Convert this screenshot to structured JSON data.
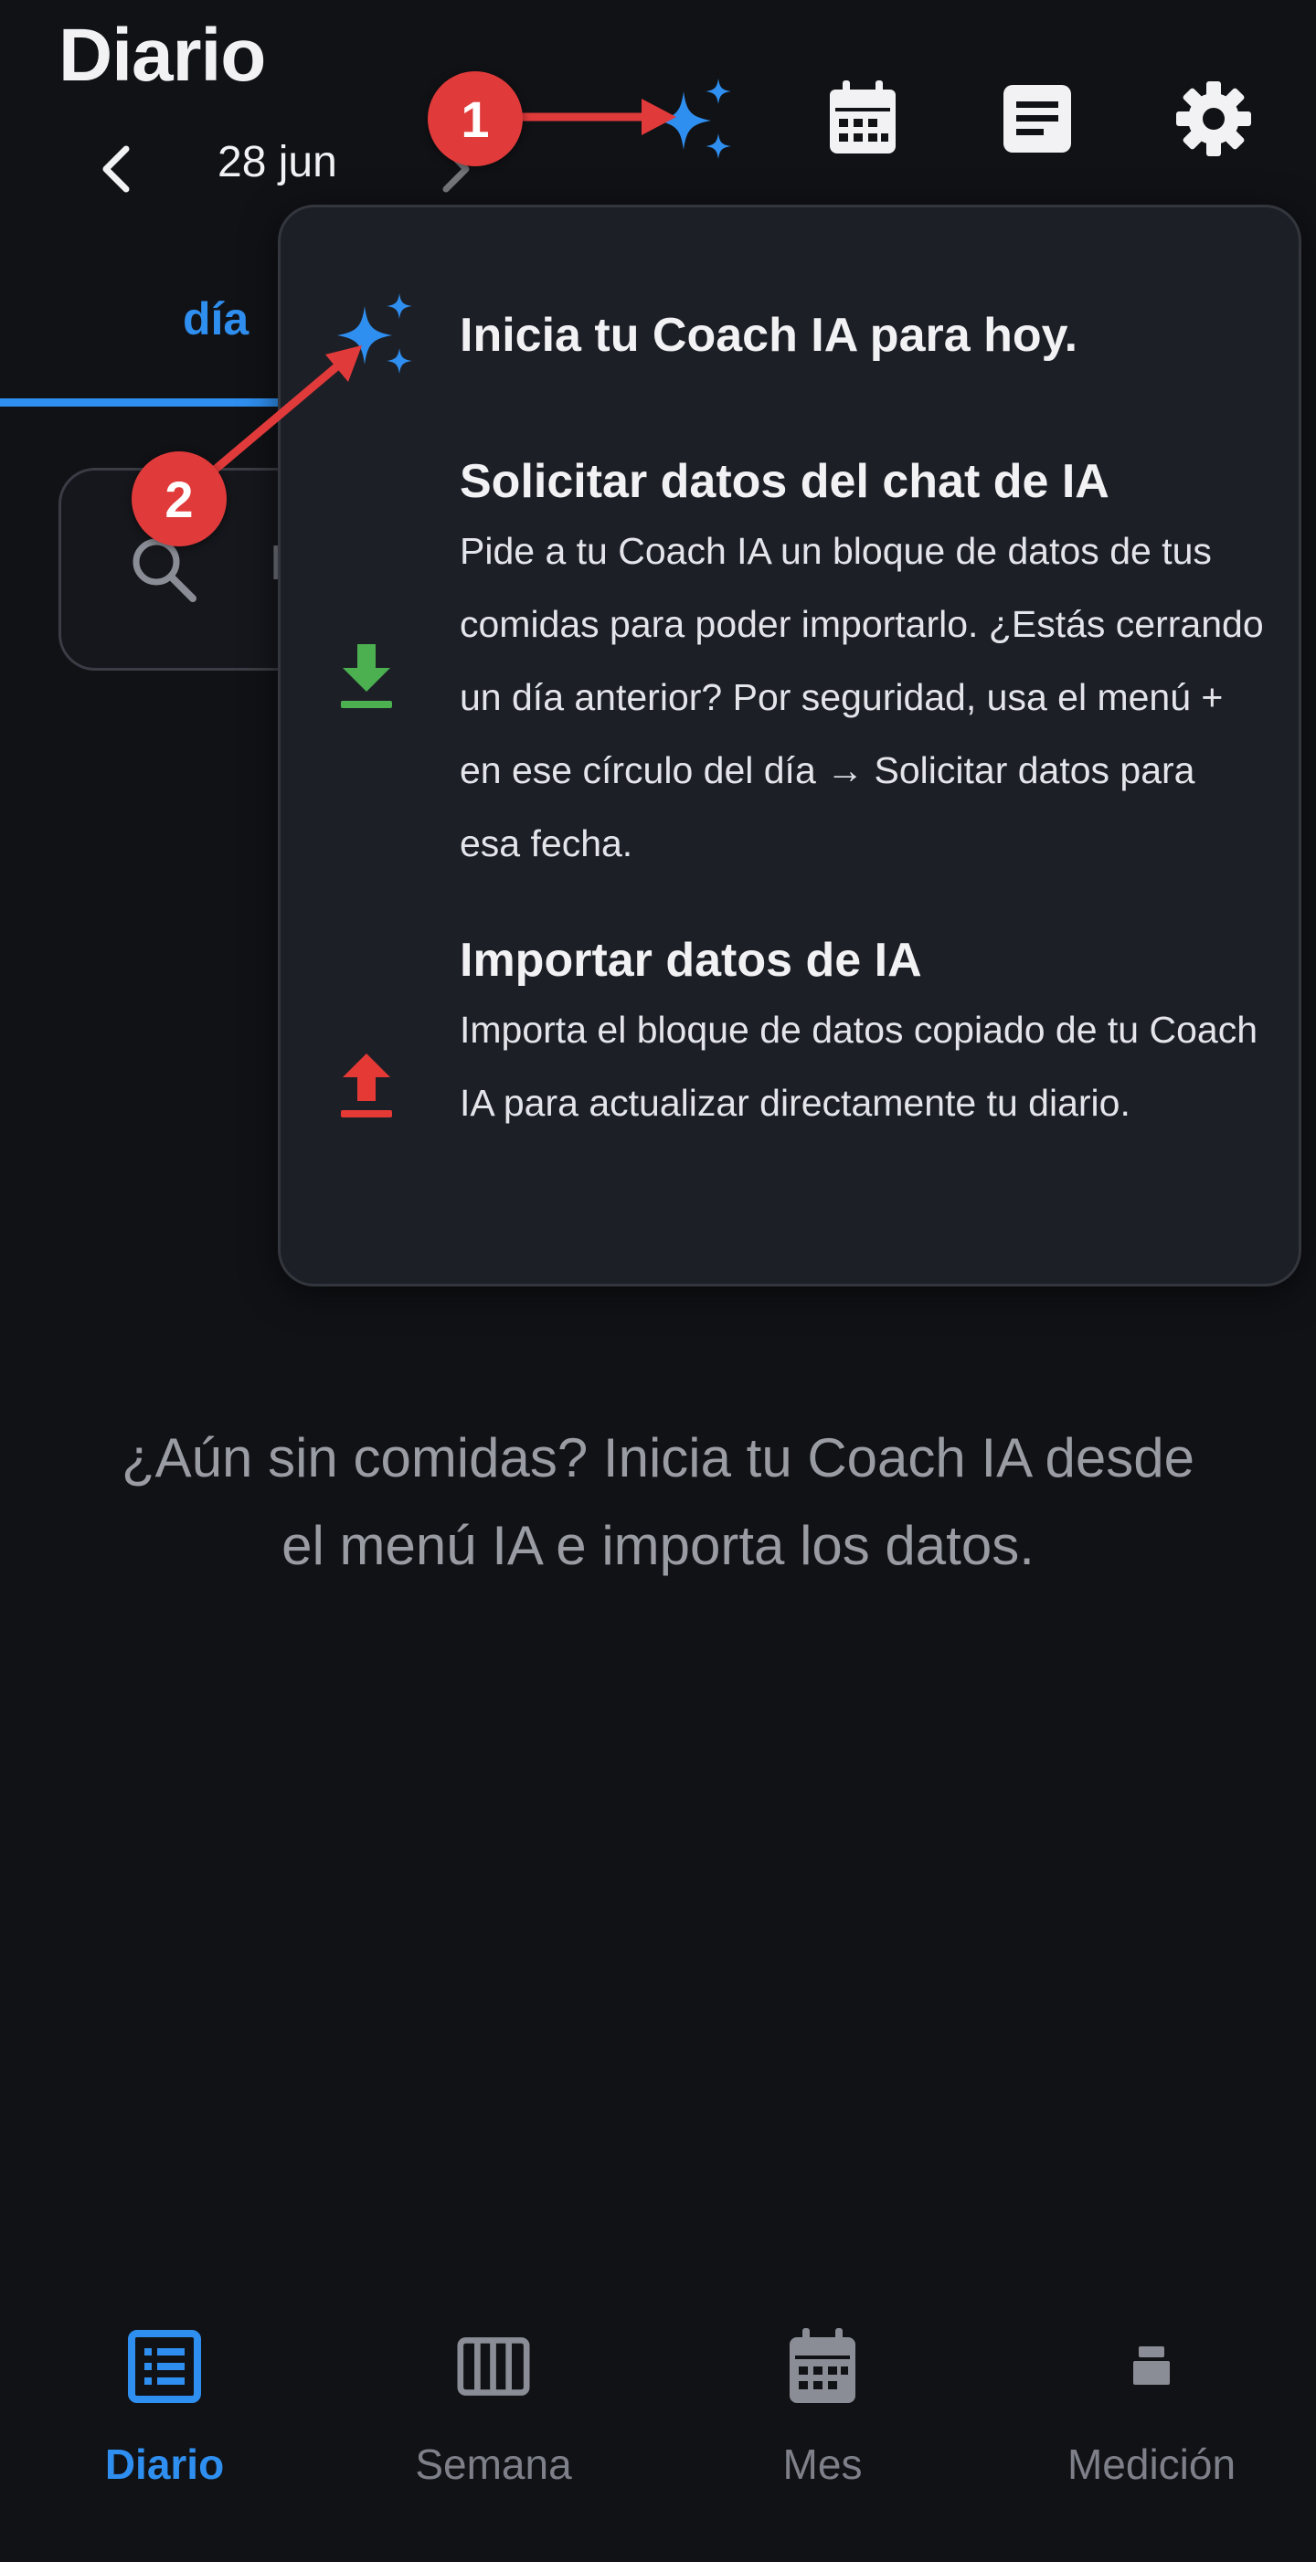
{
  "header": {
    "title": "Diario",
    "date": "28 jun"
  },
  "tabs": {
    "active_label": "día"
  },
  "search": {
    "placeholder": "B"
  },
  "ai_menu": {
    "start": {
      "title": "Inicia tu Coach IA para hoy."
    },
    "request": {
      "title": "Solicitar datos del chat de IA",
      "description": "Pide a tu Coach IA un bloque de datos de tus comidas para poder importarlo. ¿Estás cerrando un día anterior? Por seguridad, usa el menú + en ese círculo del día → Solicitar datos para esa fecha."
    },
    "import": {
      "title": "Importar datos de IA",
      "description": "Importa el bloque de datos copiado de tu Coach IA para actualizar directamente tu diario."
    }
  },
  "empty_state": {
    "message": "¿Aún sin comidas? Inicia tu Coach IA desde el menú IA e importa los datos."
  },
  "bottom_nav": [
    {
      "label": "Diario",
      "icon": "list-icon",
      "active": true
    },
    {
      "label": "Semana",
      "icon": "week-columns-icon",
      "active": false
    },
    {
      "label": "Mes",
      "icon": "calendar-icon",
      "active": false
    },
    {
      "label": "Medición",
      "icon": "scale-icon",
      "active": false
    }
  ],
  "annotations": [
    {
      "number": "1"
    },
    {
      "number": "2"
    }
  ],
  "colors": {
    "background": "#111216",
    "accent": "#2f8ff0",
    "menu_bg": "#1d1f26",
    "download_green": "#4caf50",
    "upload_red": "#e53935",
    "annotation_red": "#e13a3a"
  }
}
